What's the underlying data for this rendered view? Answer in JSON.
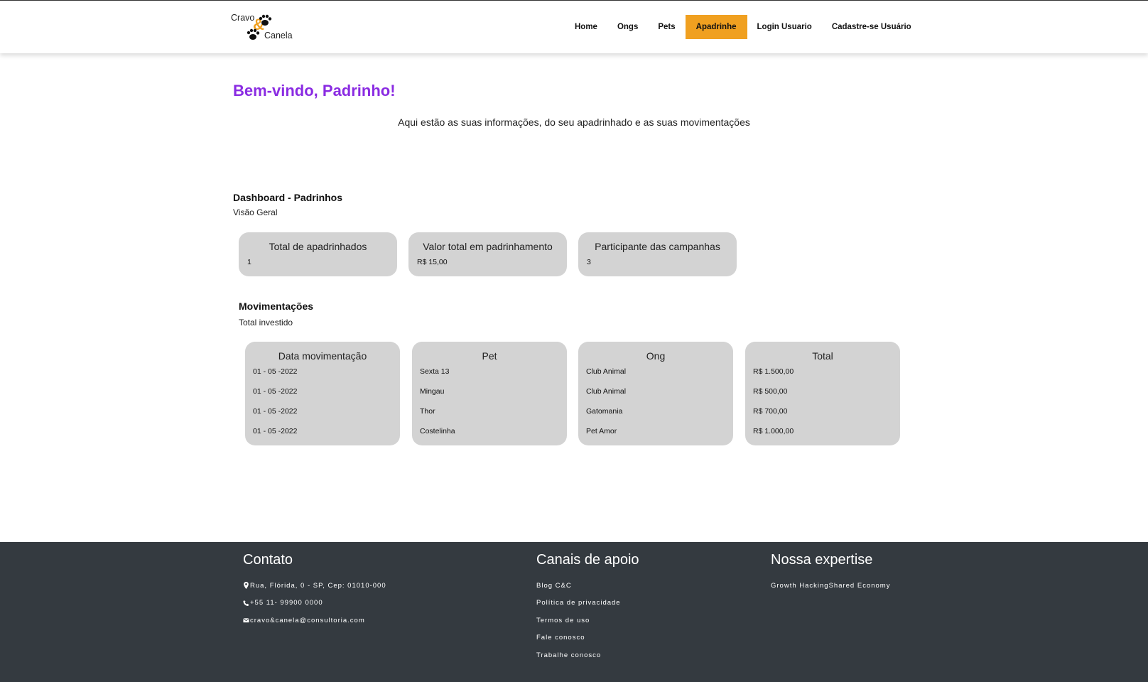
{
  "header": {
    "logo": {
      "word1": "Cravo",
      "amp": "&",
      "word2": "Canela"
    },
    "nav": [
      {
        "label": "Home",
        "active": false
      },
      {
        "label": "Ongs",
        "active": false
      },
      {
        "label": "Pets",
        "active": false
      },
      {
        "label": "Apadrinhe",
        "active": true
      },
      {
        "label": "Login Usuario",
        "active": false
      },
      {
        "label": "Cadastre-se Usuário",
        "active": false
      }
    ],
    "accent_color": "#f0a020"
  },
  "welcome": {
    "title": "Bem-vindo, Padrinho!",
    "title_color": "#8a2be2",
    "subtitle": "Aqui estão as suas informações, do seu apadrinhado e as suas movimentações"
  },
  "dashboard": {
    "title": "Dashboard - Padrinhos",
    "subtitle": "Visão Geral",
    "cards": [
      {
        "label": "Total de apadrinhados",
        "value": "1"
      },
      {
        "label": "Valor total em padrinhamento",
        "value": "R$ 15,00"
      },
      {
        "label": "Participante das campanhas",
        "value": "3"
      }
    ]
  },
  "movimentacoes": {
    "title": "Movimentações",
    "subtitle": "Total investido",
    "columns": [
      {
        "header": "Data movimentação",
        "cells": [
          "01 - 05 -2022",
          "01 - 05 -2022",
          "01 - 05 -2022",
          "01 - 05 -2022"
        ]
      },
      {
        "header": "Pet",
        "cells": [
          "Sexta 13",
          "Mingau",
          "Thor",
          "Costelinha"
        ]
      },
      {
        "header": "Ong",
        "cells": [
          "Club Animal",
          "Club Animal",
          "Gatomania",
          "Pet Amor"
        ]
      },
      {
        "header": "Total",
        "cells": [
          "R$ 1.500,00",
          "R$ 500,00",
          "R$ 700,00",
          "R$ 1.000,00"
        ]
      }
    ]
  },
  "footer": {
    "background": "#343a40",
    "contato": {
      "title": "Contato",
      "address": "Rua, Flórida, 0 - SP, Cep: 01010-000",
      "phone": "+55 11- 99900 0000",
      "email": "cravo&canela@consultoria.com",
      "icons": [
        "map-pin-icon",
        "phone-icon",
        "envelope-icon"
      ]
    },
    "canais": {
      "title": "Canais de apoio",
      "links": [
        "Blog C&C",
        "Política de privacidade",
        "Termos de uso",
        "Fale conosco",
        "Trabalhe conosco"
      ]
    },
    "expertise": {
      "title": "Nossa expertise",
      "text": "Growth HackingShared Economy"
    }
  }
}
